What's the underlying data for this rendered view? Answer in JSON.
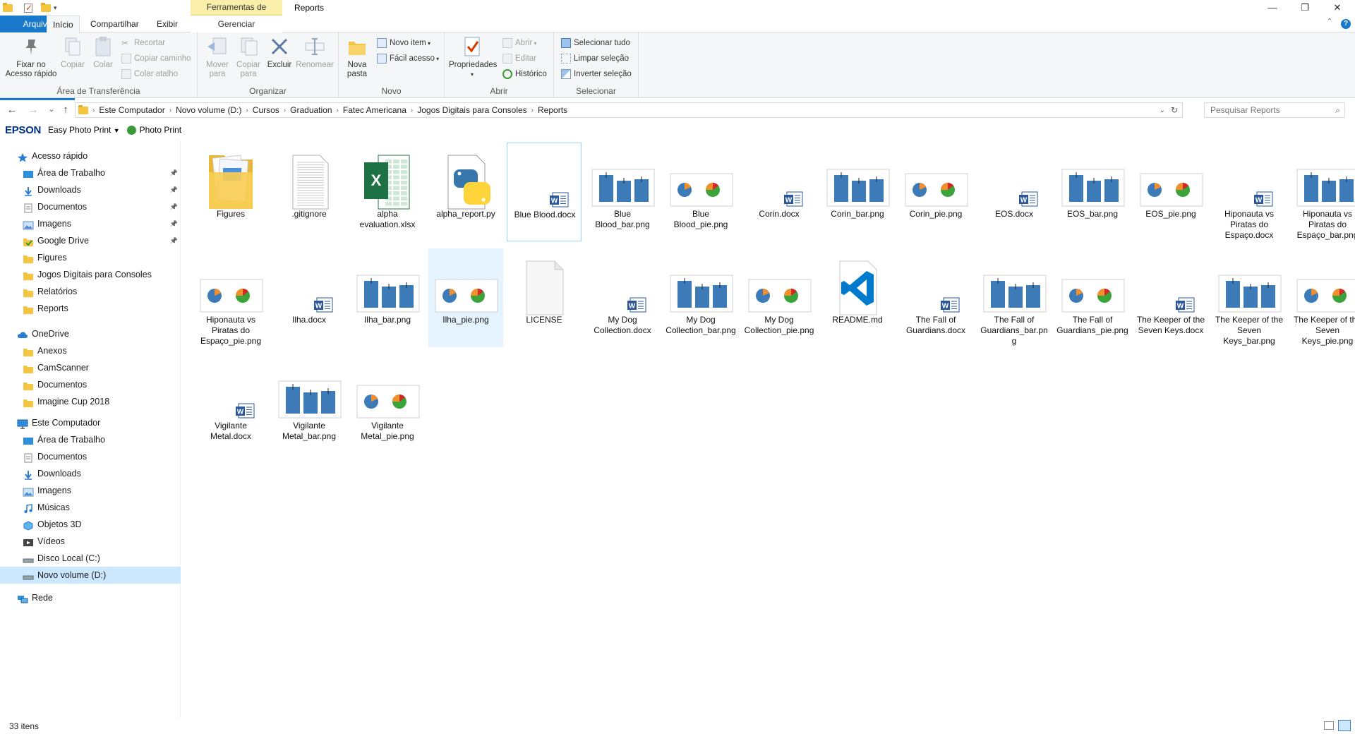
{
  "window": {
    "title": "Reports",
    "context_tab_group": "Ferramentas de Imagem",
    "minimize": "—",
    "maximize": "❐",
    "close": "✕"
  },
  "tabs": {
    "file": "Arquivo",
    "home": "Início",
    "share": "Compartilhar",
    "view": "Exibir",
    "manage": "Gerenciar"
  },
  "ribbon": {
    "clipboard": {
      "label": "Área de Transferência",
      "pin": "Fixar no Acesso rápido",
      "copy": "Copiar",
      "paste": "Colar",
      "cut": "Recortar",
      "copy_path": "Copiar caminho",
      "paste_shortcut": "Colar atalho"
    },
    "organize": {
      "label": "Organizar",
      "move_to": "Mover para",
      "copy_to": "Copiar para",
      "delete": "Excluir",
      "rename": "Renomear"
    },
    "new": {
      "label": "Novo",
      "new_folder": "Nova pasta",
      "new_item": "Novo item",
      "easy_access": "Fácil acesso"
    },
    "open": {
      "label": "Abrir",
      "properties": "Propriedades",
      "open": "Abrir",
      "edit": "Editar",
      "history": "Histórico"
    },
    "select": {
      "label": "Selecionar",
      "select_all": "Selecionar tudo",
      "select_none": "Limpar seleção",
      "invert": "Inverter seleção"
    }
  },
  "address": {
    "crumbs": [
      "Este Computador",
      "Novo volume (D:)",
      "Cursos",
      "Graduation",
      "Fatec Americana",
      "Jogos Digitais para Consoles",
      "Reports"
    ],
    "search_placeholder": "Pesquisar Reports"
  },
  "epson": {
    "brand": "EPSON",
    "easy_photo_print": "Easy Photo Print",
    "photo_print": "Photo Print"
  },
  "navpane": {
    "quick_access": "Acesso rápido",
    "quick_items": [
      "Área de Trabalho",
      "Downloads",
      "Documentos",
      "Imagens",
      "Google Drive",
      "Figures",
      "Jogos Digitais para Consoles",
      "Relatórios",
      "Reports"
    ],
    "onedrive": "OneDrive",
    "onedrive_items": [
      "Anexos",
      "CamScanner",
      "Documentos",
      "Imagine Cup 2018"
    ],
    "this_pc": "Este Computador",
    "pc_items": [
      "Área de Trabalho",
      "Documentos",
      "Downloads",
      "Imagens",
      "Músicas",
      "Objetos 3D",
      "Vídeos",
      "Disco Local (C:)",
      "Novo volume (D:)"
    ],
    "network": "Rede"
  },
  "files": [
    {
      "name": "Figures",
      "type": "folder"
    },
    {
      "name": ".gitignore",
      "type": "text"
    },
    {
      "name": "alpha evaluation.xlsx",
      "type": "excel"
    },
    {
      "name": "alpha_report.py",
      "type": "python"
    },
    {
      "name": "Blue Blood.docx",
      "type": "word"
    },
    {
      "name": "Blue Blood_bar.png",
      "type": "bar"
    },
    {
      "name": "Blue Blood_pie.png",
      "type": "pie"
    },
    {
      "name": "Corin.docx",
      "type": "word"
    },
    {
      "name": "Corin_bar.png",
      "type": "bar"
    },
    {
      "name": "Corin_pie.png",
      "type": "pie"
    },
    {
      "name": "EOS.docx",
      "type": "word"
    },
    {
      "name": "EOS_bar.png",
      "type": "bar"
    },
    {
      "name": "EOS_pie.png",
      "type": "pie"
    },
    {
      "name": "Hiponauta vs Piratas do Espaço.docx",
      "type": "word"
    },
    {
      "name": "Hiponauta vs Piratas do Espaço_bar.png",
      "type": "bar"
    },
    {
      "name": "Hiponauta vs Piratas do Espaço_pie.png",
      "type": "pie"
    },
    {
      "name": "Ilha.docx",
      "type": "word"
    },
    {
      "name": "Ilha_bar.png",
      "type": "bar"
    },
    {
      "name": "Ilha_pie.png",
      "type": "pie"
    },
    {
      "name": "LICENSE",
      "type": "blank"
    },
    {
      "name": "My Dog Collection.docx",
      "type": "word"
    },
    {
      "name": "My Dog Collection_bar.png",
      "type": "bar"
    },
    {
      "name": "My Dog Collection_pie.png",
      "type": "pie"
    },
    {
      "name": "README.md",
      "type": "vscode"
    },
    {
      "name": "The Fall of Guardians.docx",
      "type": "word"
    },
    {
      "name": "The Fall of Guardians_bar.png",
      "type": "bar"
    },
    {
      "name": "The Fall of Guardians_pie.png",
      "type": "pie"
    },
    {
      "name": "The Keeper of the Seven Keys.docx",
      "type": "word"
    },
    {
      "name": "The Keeper of the Seven Keys_bar.png",
      "type": "bar"
    },
    {
      "name": "The Keeper of the Seven Keys_pie.png",
      "type": "pie"
    },
    {
      "name": "Vigilante Metal.docx",
      "type": "word"
    },
    {
      "name": "Vigilante Metal_bar.png",
      "type": "bar"
    },
    {
      "name": "Vigilante Metal_pie.png",
      "type": "pie"
    }
  ],
  "selected_file": "Ilha_pie.png",
  "focused_file": "Blue Blood.docx",
  "status": {
    "count": "33 itens"
  },
  "colors": {
    "accent": "#1979ca",
    "selection": "#cce8ff",
    "folder": "#f5c542",
    "chart_blue": "#3d7ab8",
    "chart_orange": "#f28e2b",
    "chart_green": "#3aa33a",
    "chart_red": "#d62728"
  }
}
